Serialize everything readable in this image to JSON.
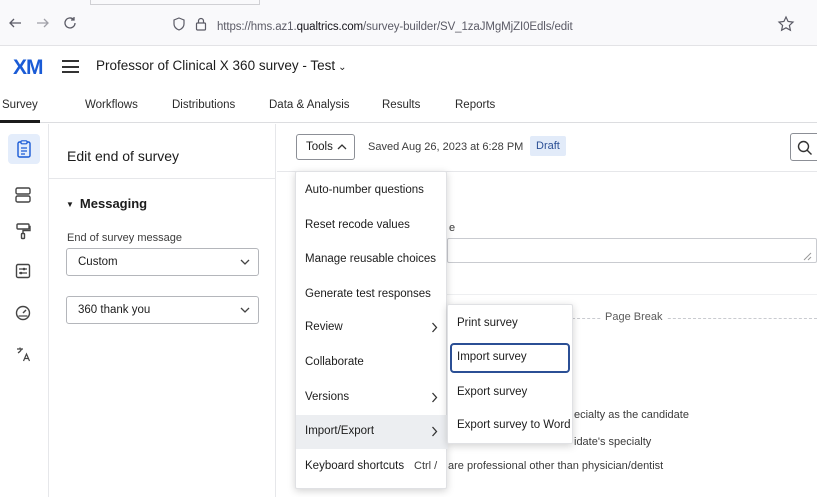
{
  "browser": {
    "url_prefix": "https://hms.az1.",
    "url_domain": "qualtrics.com",
    "url_path": "/survey-builder/SV_1zaJMgMjZI0Edls/edit",
    "icons": [
      "back-arrow-icon",
      "forward-arrow-icon",
      "reload-icon",
      "shield-icon",
      "lock-icon",
      "bookmark-star-icon"
    ]
  },
  "header": {
    "logo": "XM",
    "project_title": "Professor of Clinical X 360 survey - Test",
    "title_caret": "⌄"
  },
  "tabs": [
    {
      "label": "Survey",
      "active": true
    },
    {
      "label": "Workflows"
    },
    {
      "label": "Distributions"
    },
    {
      "label": "Data & Analysis"
    },
    {
      "label": "Results"
    },
    {
      "label": "Reports"
    }
  ],
  "rail": {
    "icons": [
      "survey-icon",
      "flow-icon",
      "look-and-feel-icon",
      "options-icon",
      "tools-icon",
      "translate-icon"
    ]
  },
  "panel": {
    "title": "Edit end of survey",
    "section_title": "Messaging",
    "field_label": "End of survey message",
    "message_type_value": "Custom",
    "message_value": "360 thank you"
  },
  "toolbar": {
    "tools_label": "Tools",
    "saved_text": "Saved Aug 26, 2023 at 6:28 PM",
    "draft_badge": "Draft"
  },
  "background_content": {
    "frag_e": "e",
    "page_break": "Page Break",
    "line1": "ecialty as the candidate",
    "line2": "idate's specialty",
    "line3": "are professional other than physician/dentist"
  },
  "tools_menu": {
    "items": [
      {
        "label": "Auto-number questions"
      },
      {
        "label": "Reset recode values"
      },
      {
        "label": "Manage reusable choices"
      },
      {
        "label": "Generate test responses"
      },
      {
        "label": "Review",
        "has_submenu": true
      },
      {
        "label": "Collaborate"
      },
      {
        "label": "Versions",
        "has_submenu": true
      },
      {
        "label": "Import/Export",
        "has_submenu": true,
        "hovered": true
      },
      {
        "label": "Keyboard shortcuts",
        "shortcut": "Ctrl /"
      }
    ]
  },
  "import_export_submenu": {
    "items": [
      {
        "label": "Print survey"
      },
      {
        "label": "Import survey",
        "focused": true
      },
      {
        "label": "Export survey"
      },
      {
        "label": "Export survey to Word"
      }
    ]
  },
  "colors": {
    "logo_blue": "#1a5bd6",
    "focus_ring": "#2b4f95",
    "draft_bg": "#e2ebf9",
    "rail_active_bg": "#e4edfb"
  }
}
